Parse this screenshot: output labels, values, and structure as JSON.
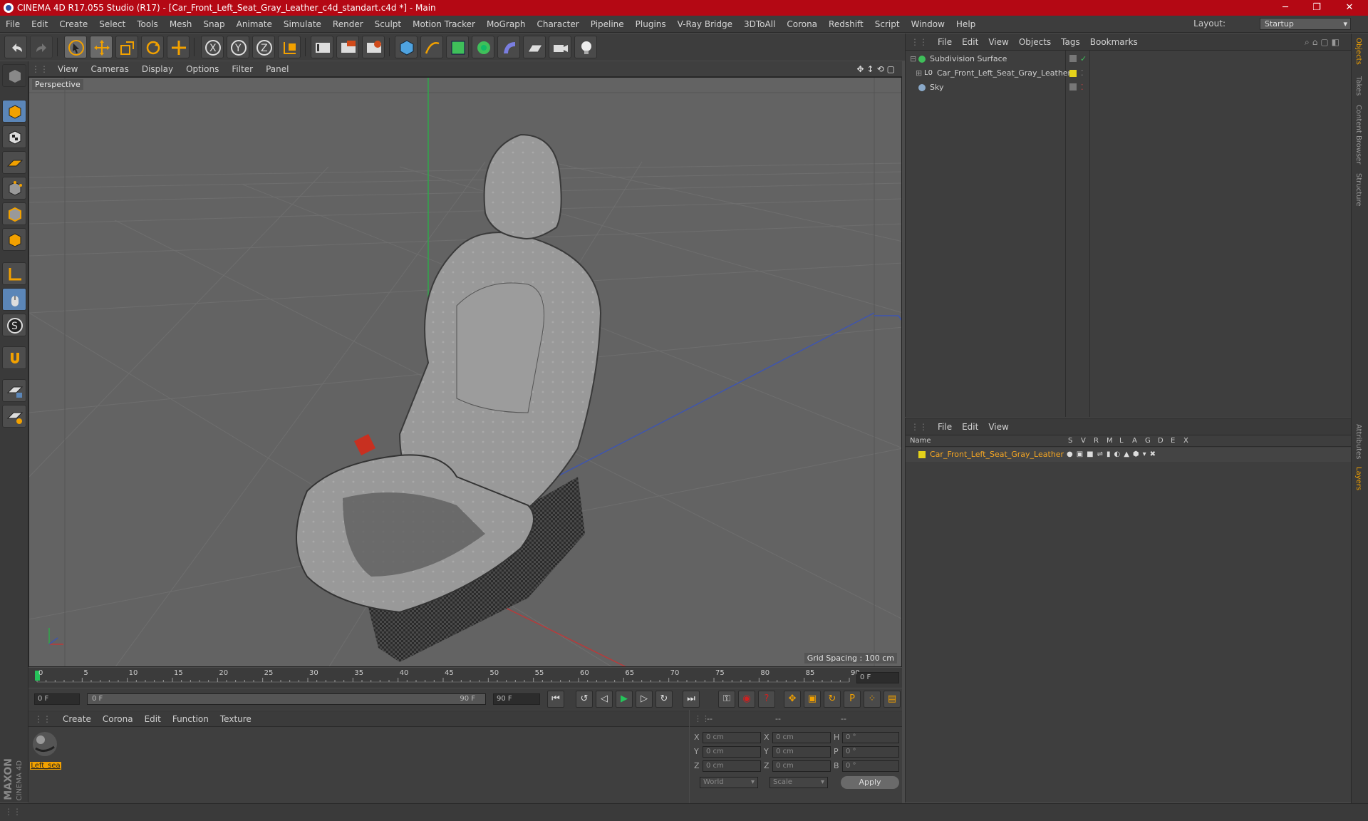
{
  "window": {
    "title": "CINEMA 4D R17.055 Studio (R17) - [Car_Front_Left_Seat_Gray_Leather_c4d_standart.c4d *] - Main",
    "minimize": "─",
    "restore": "❐",
    "close": "✕"
  },
  "menubar": {
    "items": [
      "File",
      "Edit",
      "Create",
      "Select",
      "Tools",
      "Mesh",
      "Snap",
      "Animate",
      "Simulate",
      "Render",
      "Sculpt",
      "Motion Tracker",
      "MoGraph",
      "Character",
      "Pipeline",
      "Plugins",
      "V-Ray Bridge",
      "3DToAll",
      "Corona",
      "Redshift",
      "Script",
      "Window",
      "Help"
    ],
    "layout_label": "Layout:",
    "layout_value": "Startup"
  },
  "viewport": {
    "menu": [
      "View",
      "Cameras",
      "Display",
      "Options",
      "Filter",
      "Panel"
    ],
    "label": "Perspective",
    "grid_spacing": "Grid Spacing : 100 cm"
  },
  "timeline": {
    "ticks": [
      "0",
      "5",
      "10",
      "15",
      "20",
      "25",
      "30",
      "35",
      "40",
      "45",
      "50",
      "55",
      "60",
      "65",
      "70",
      "75",
      "80",
      "85",
      "90"
    ],
    "current_frame": "0 F",
    "start_field": "0 F",
    "range_start": "0 F",
    "range_end": "90 F",
    "end_field": "90 F"
  },
  "material_panel": {
    "menu": [
      "Create",
      "Corona",
      "Edit",
      "Function",
      "Texture"
    ],
    "materials": [
      {
        "name": "Left_sea"
      }
    ]
  },
  "coordinates": {
    "header": [
      "--",
      "--",
      "--"
    ],
    "rows": [
      {
        "a": "X",
        "av": "0 cm",
        "b": "X",
        "bv": "0 cm",
        "c": "H",
        "cv": "0 °"
      },
      {
        "a": "Y",
        "av": "0 cm",
        "b": "Y",
        "bv": "0 cm",
        "c": "P",
        "cv": "0 °"
      },
      {
        "a": "Z",
        "av": "0 cm",
        "b": "Z",
        "bv": "0 cm",
        "c": "B",
        "cv": "0 °"
      }
    ],
    "world": "World",
    "scale": "Scale",
    "apply": "Apply"
  },
  "objects_panel": {
    "menu": [
      "File",
      "Edit",
      "View",
      "Objects",
      "Tags",
      "Bookmarks"
    ],
    "objects": [
      {
        "name": "Subdivision Surface",
        "icon": "subdivision-icon"
      },
      {
        "name": "Car_Front_Left_Seat_Gray_Leather",
        "icon": "null-object-icon"
      },
      {
        "name": "Sky",
        "icon": "sky-icon"
      }
    ]
  },
  "layers_panel": {
    "menu": [
      "File",
      "Edit",
      "View"
    ],
    "columns": {
      "name": "Name",
      "flags": [
        "S",
        "V",
        "R",
        "M",
        "L",
        "A",
        "G",
        "D",
        "E",
        "X"
      ]
    },
    "layers": [
      {
        "name": "Car_Front_Left_Seat_Gray_Leather"
      }
    ]
  },
  "right_tabs": [
    "Objects",
    "Takes",
    "Content Browser",
    "Structure",
    "Attributes",
    "Layers"
  ],
  "branding": {
    "maxon": "MAXON",
    "cinema": "CINEMA 4D"
  },
  "colors": {
    "titlebar": "#b40814",
    "accent": "#f2a100",
    "layer_yellow": "#e5d21a",
    "selected_text": "#f5a623"
  }
}
